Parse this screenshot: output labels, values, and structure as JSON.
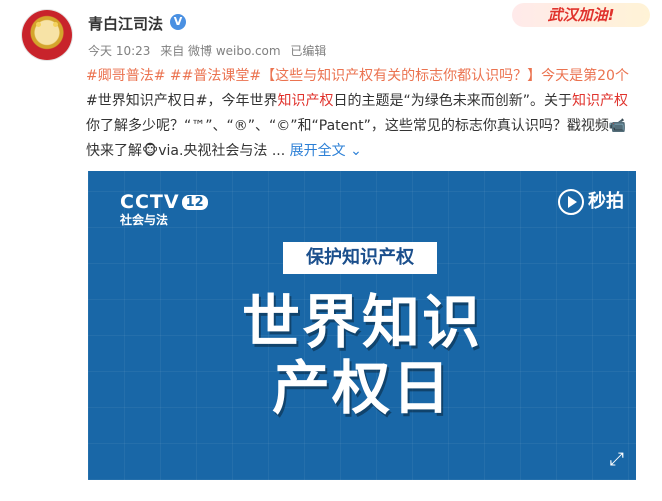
{
  "account": {
    "name": "青白江司法",
    "verified_mark": "V"
  },
  "banner": "武汉加油!",
  "meta": {
    "time": "今天 10:23",
    "source": "来自 微博 weibo.com",
    "status": "已编辑"
  },
  "post": {
    "tag1": "#卿哥普法#",
    "tag2": "##普法课堂#",
    "title": "【这些与知识产权有关的标志你都认识吗？】",
    "line1_tail": "今天是第",
    "date_text": "20个",
    "topic": "#世界知识产权日#",
    "text1": "，今年世界",
    "kw1": "知识产权",
    "text2": "日的主题是“为绿色未来而创新”。关于",
    "kw2": "知识产权",
    "text3": "你了解多少呢？“™”、“®”、“©”和“Patent”，这些常见的标志你真认识吗？戳视频",
    "text4": "快来了解",
    "text5": "via.央视社会与法",
    "ellipsis": "...",
    "expand": "展开全文"
  },
  "media": {
    "channel_logo": "CCTV",
    "channel_num": "12",
    "channel_sub": "社会与法",
    "platform": "秒拍",
    "tag": "保护知识产权",
    "title_line1": "世界知识",
    "title_line2": "产权日"
  }
}
